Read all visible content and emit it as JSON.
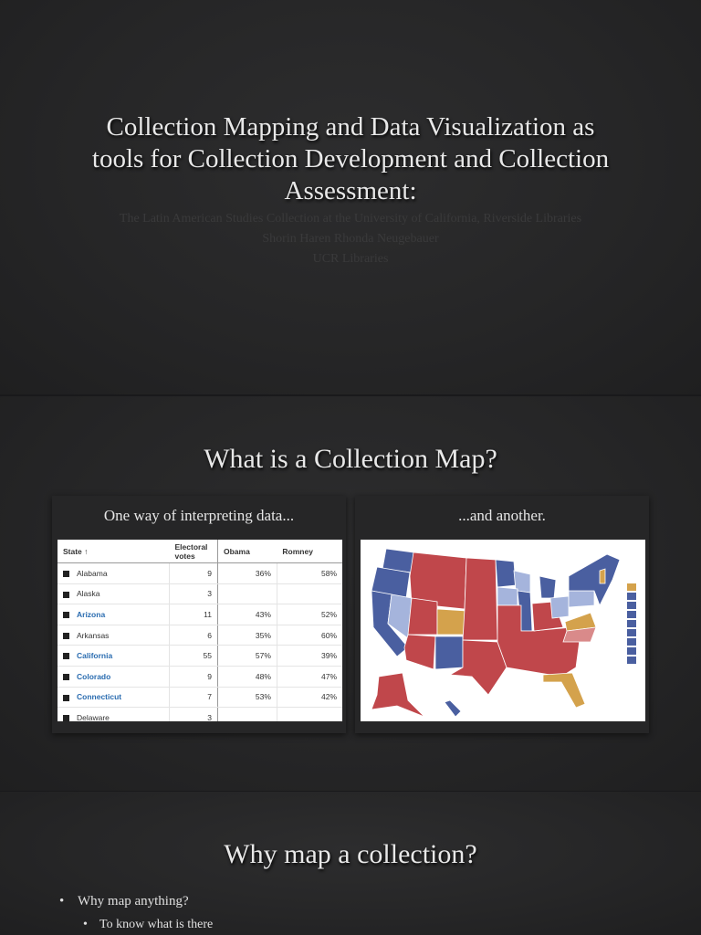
{
  "slide1": {
    "title": "Collection Mapping and Data Visualization as tools for Collection Development and Collection Assessment:",
    "subtitle": "The Latin American Studies Collection at the University of California, Riverside Libraries",
    "authors": "Shorin Haren Rhonda Neugebauer",
    "organization": "UCR Libraries"
  },
  "slide2": {
    "title": "What is a Collection Map?",
    "left_panel": {
      "heading": "One way of interpreting data...",
      "table": {
        "headers": [
          "State ↑",
          "Electoral votes",
          "Obama",
          "Romney"
        ],
        "rows": [
          {
            "state": "Alabama",
            "votes": "9",
            "obama": "36%",
            "romney": "58%",
            "link": false
          },
          {
            "state": "Alaska",
            "votes": "3",
            "obama": "",
            "romney": "",
            "link": false
          },
          {
            "state": "Arizona",
            "votes": "11",
            "obama": "43%",
            "romney": "52%",
            "link": true
          },
          {
            "state": "Arkansas",
            "votes": "6",
            "obama": "35%",
            "romney": "60%",
            "link": false
          },
          {
            "state": "California",
            "votes": "55",
            "obama": "57%",
            "romney": "39%",
            "link": true
          },
          {
            "state": "Colorado",
            "votes": "9",
            "obama": "48%",
            "romney": "47%",
            "link": true
          },
          {
            "state": "Connecticut",
            "votes": "7",
            "obama": "53%",
            "romney": "42%",
            "link": true
          },
          {
            "state": "Delaware",
            "votes": "3",
            "obama": "",
            "romney": "",
            "link": false
          }
        ]
      }
    },
    "right_panel": {
      "heading": "...and another.",
      "map_colors": {
        "republican": "#c0474b",
        "democrat": "#4a5fa0",
        "lean_dem": "#a5b4dc",
        "tossup": "#d4a24c",
        "lean_rep": "#d98a8a"
      }
    }
  },
  "slide3": {
    "title": "Why map a collection?",
    "bullets": [
      {
        "text": "Why map anything?",
        "level": 1
      },
      {
        "text": "To know what is there",
        "level": 2
      }
    ]
  }
}
